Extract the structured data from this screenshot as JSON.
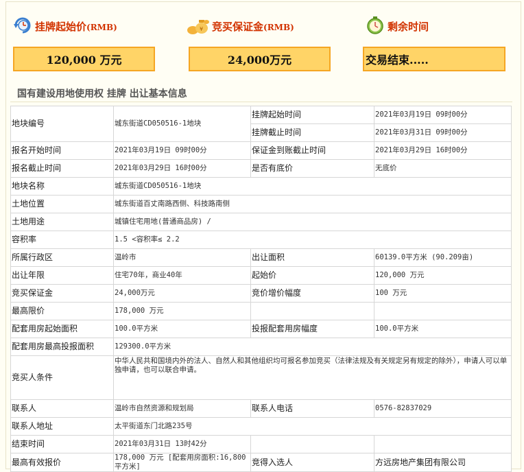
{
  "header": {
    "start_price_label": "挂牌起始价",
    "start_price_unit": "(RMB)",
    "deposit_label": "竞买保证金",
    "deposit_unit": "(RMB)",
    "remaining_label": "剩余时间",
    "start_price_value": "120,000 万元",
    "deposit_value": "24,000万元",
    "remaining_value": "交易结束....."
  },
  "section_title": "国有建设用地使用权 挂牌 出让基本信息",
  "colors": {
    "accent": "#d23300",
    "box_fill": "#ffd467",
    "box_border": "#f5a623"
  },
  "rows": {
    "parcel_no_k": "地块编号",
    "parcel_no_v": "城东街道CD050516-1地块",
    "listing_start_k": "挂牌起始时间",
    "listing_start_v": "2021年03月19日 09时00分",
    "listing_end_k": "挂牌截止时间",
    "listing_end_v": "2021年03月31日 09时00分",
    "signup_start_k": "报名开始时间",
    "signup_start_v": "2021年03月19日 09时00分",
    "deposit_deadline_k": "保证金到账截止时间",
    "deposit_deadline_v": "2021年03月29日 16时00分",
    "signup_end_k": "报名截止时间",
    "signup_end_v": "2021年03月29日 16时00分",
    "reserve_k": "是否有底价",
    "reserve_v": "无底价",
    "parcel_name_k": "地块名称",
    "parcel_name_v": "城东街道CD050516-1地块",
    "location_k": "土地位置",
    "location_v": "城东街道百丈南路西侧、科技路南侧",
    "usage_k": "土地用途",
    "usage_v": "城镇住宅用地(普通商品房) /",
    "far_k": "容积率",
    "far_v": "1.5 <容积率≤ 2.2",
    "district_k": "所属行政区",
    "district_v": "温岭市",
    "area_k": "出让面积",
    "area_v": "60139.0平方米 (90.209亩)",
    "term_k": "出让年限",
    "term_v": "住宅70年，商业40年",
    "start_price_k": "起始价",
    "start_price_v": "120,000 万元",
    "bid_deposit_k": "竞买保证金",
    "bid_deposit_v": "24,000万元",
    "increment_k": "竞价增价幅度",
    "increment_v": "100 万元",
    "max_price_k": "最高限价",
    "max_price_v": "178,000 万元",
    "housing_start_k": "配套用房起始面积",
    "housing_start_v": "100.0平方米",
    "housing_step_k": "投报配套用房幅度",
    "housing_step_v": "100.0平方米",
    "housing_max_k": "配套用房最高投报面积",
    "housing_max_v": "129300.0平方米",
    "bidder_k": "竞买人条件",
    "bidder_v": "中华人民共和国境内外的法人、自然人和其他组织均可报名参加竞买（法律法规及有关规定另有规定的除外），申请人可以单独申请，也可以联合申请。",
    "contact_k": "联系人",
    "contact_v": "温岭市自然资源和规划局",
    "phone_k": "联系人电话",
    "phone_v": "0576-82837029",
    "address_k": "联系人地址",
    "address_v": "太平街道东门北路235号",
    "end_time_k": "结束时间",
    "end_time_v": "2021年03月31日 13时42分",
    "best_price_k": "最高有效报价",
    "best_price_v": "178,000 万元 [配套用房面积:16,800平方米]",
    "winner_k": "竞得入选人",
    "winner_v": "方远房地产集团有限公司"
  }
}
